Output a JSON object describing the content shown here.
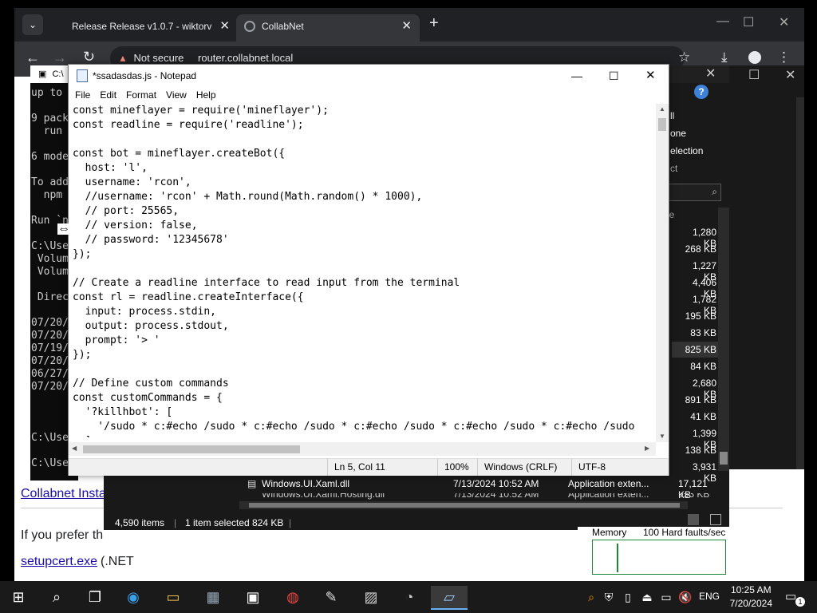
{
  "browser": {
    "tabs": [
      {
        "label": "Release Release v1.0.7 - wiktorv"
      },
      {
        "label": "CollabNet"
      }
    ],
    "new_tab": "+",
    "url": "router.collabnet.local",
    "security_label": "Not secure",
    "page": {
      "link_collabnet_installer": "Collabnet Insta",
      "text_prefer": "If you prefer th",
      "link_setupcert": "setupcert.exe",
      "text_net": "(.NET"
    }
  },
  "console": {
    "title": "C:\\",
    "lines": [
      "up to",
      "9 pack",
      "  run",
      "6 mode",
      "To add",
      "  npm",
      "Run `n",
      "C:\\Use",
      " Volum",
      " Volum",
      " Direc",
      "07/20/",
      "07/20/",
      "07/19/",
      "07/20/",
      "06/27/",
      "07/20/",
      "C:\\Use",
      "C:\\Use"
    ]
  },
  "explorer": {
    "ribbon_items": [
      "ll",
      "one",
      "election",
      "ct"
    ],
    "size_header": "ize",
    "sizes": [
      "1,280 KB",
      "268 KB",
      "1,227 KB",
      "4,406 KB",
      "1,782 KB",
      "195 KB",
      "83 KB",
      "825 KB",
      "84 KB",
      "2,680 KB",
      "891 KB",
      "41 KB",
      "1,399 KB",
      "138 KB",
      "3,931 KB"
    ],
    "row": {
      "name": "Windows.UI.Xaml.dll",
      "date": "7/13/2024 10:52 AM",
      "type": "Application exten...",
      "size": "17,121 KB"
    },
    "row_partial": {
      "name": "Windows.UI.Xaml.Hosting.dll",
      "date": "7/13/2024 10:52 AM",
      "type": "Application exten...",
      "size": "953 KB"
    },
    "status_items": "4,590 items",
    "status_selected": "1 item selected  824 KB"
  },
  "taskmgr": {
    "memory_label": "Memory",
    "faults_label": "100 Hard faults/sec"
  },
  "notepad": {
    "title": "*ssadasdas.js - Notepad",
    "menu": [
      "File",
      "Edit",
      "Format",
      "View",
      "Help"
    ],
    "code_lines": [
      "const mineflayer = require('mineflayer');",
      "const readline = require('readline');",
      "",
      "const bot = mineflayer.createBot({",
      "  host: 'l',",
      "  username: 'rcon',",
      "  //username: 'rcon' + Math.round(Math.random() * 1000),",
      "  // port: 25565,",
      "  // version: false,",
      "  // password: '12345678'",
      "});",
      "",
      "// Create a readline interface to read input from the terminal",
      "const rl = readline.createInterface({",
      "  input: process.stdin,",
      "  output: process.stdout,",
      "  prompt: '> '",
      "});",
      "",
      "// Define custom commands",
      "const customCommands = {",
      "  '?killhbot': [",
      "    '/sudo * c:#echo /sudo * c:#echo /sudo * c:#echo /sudo * c:#echo /sudo * c:#echo /sudo",
      "  ]"
    ],
    "status": {
      "position": "Ln 5, Col 11",
      "zoom": "100%",
      "line_ending": "Windows (CRLF)",
      "encoding": "UTF-8"
    }
  },
  "taskbar": {
    "language": "ENG",
    "time": "10:25 AM",
    "date": "7/20/2024",
    "notification_count": "1"
  }
}
